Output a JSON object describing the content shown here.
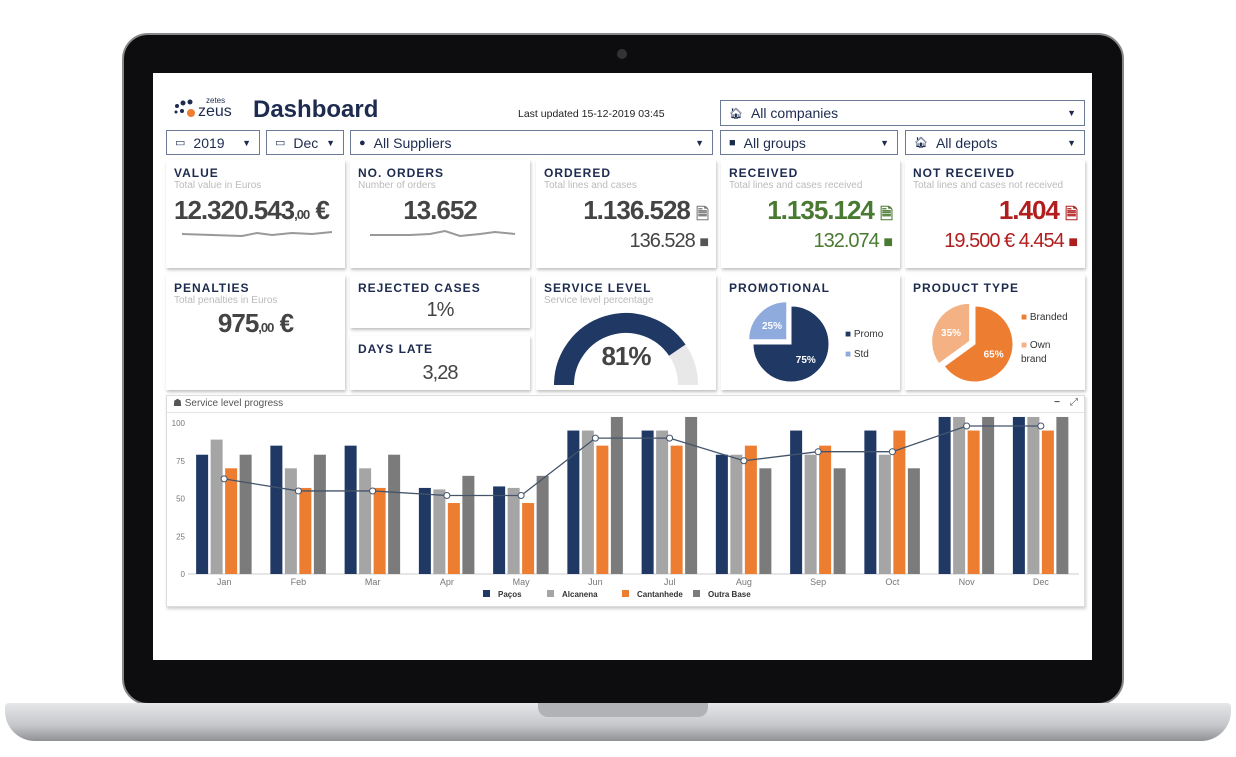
{
  "header": {
    "logo_small": "zetes",
    "logo": "zeus",
    "title": "Dashboard",
    "last_updated": "Last updated 15-12-2019 03:45"
  },
  "filters": {
    "companies": "All companies",
    "year": "2019",
    "month": "Dec",
    "suppliers": "All Suppliers",
    "groups": "All groups",
    "depots": "All depots"
  },
  "kpis": {
    "value": {
      "title": "VALUE",
      "subtitle": "Total value in Euros",
      "int": "12.320.543",
      "dec": ",00",
      "unit": "€"
    },
    "orders": {
      "title": "NO. ORDERS",
      "subtitle": "Number of orders",
      "value": "13.652"
    },
    "ordered": {
      "title": "ORDERED",
      "subtitle": "Total lines and cases",
      "lines": "1.136.528",
      "cases": "136.528"
    },
    "received": {
      "title": "RECEIVED",
      "subtitle": "Total lines and cases received",
      "lines": "1.135.124",
      "cases": "132.074",
      "color": "#4a7a32"
    },
    "not_received": {
      "title": "NOT RECEIVED",
      "subtitle": "Total lines and cases not received",
      "lines": "1.404",
      "value": "19.500 €",
      "cases": "4.454",
      "color": "#b01e1e"
    },
    "penalties": {
      "title": "PENALTIES",
      "subtitle": "Total penalties in Euros",
      "int": "975",
      "dec": ",00",
      "unit": "€"
    },
    "rejected": {
      "title": "REJECTED CASES",
      "value": "1%"
    },
    "days_late": {
      "title": "DAYS LATE",
      "value": "3,28"
    },
    "service_level": {
      "title": "SERVICE LEVEL",
      "subtitle": "Service level percentage",
      "value": "81%",
      "percent": 81
    },
    "promotional": {
      "title": "PROMOTIONAL",
      "slices": [
        {
          "label": "Promo",
          "value": 75,
          "text": "75%",
          "color": "#1f3864"
        },
        {
          "label": "Std",
          "value": 25,
          "text": "25%",
          "color": "#8faadc"
        }
      ]
    },
    "product_type": {
      "title": "PRODUCT TYPE",
      "slices": [
        {
          "label": "Branded",
          "value": 65,
          "text": "65%",
          "color": "#ed7d31"
        },
        {
          "label": "Own brand",
          "value": 35,
          "text": "35%",
          "color": "#f4b183"
        }
      ]
    }
  },
  "chart_panel": {
    "title": "Service level progress",
    "minimize": "−",
    "expand": "⤢"
  },
  "chart_data": {
    "type": "bar",
    "categories": [
      "Jan",
      "Feb",
      "Mar",
      "Apr",
      "May",
      "Jun",
      "Jul",
      "Aug",
      "Sep",
      "Oct",
      "Nov",
      "Dec"
    ],
    "y_ticks": [
      "0",
      "25",
      "50",
      "75",
      "100"
    ],
    "ylim": [
      0,
      105
    ],
    "grid": false,
    "legend": "bottom",
    "series": [
      {
        "name": "Paços",
        "color": "#1f3864",
        "values": [
          79,
          85,
          85,
          57,
          58,
          95,
          95,
          79,
          95,
          95,
          104,
          104
        ]
      },
      {
        "name": "Alcanena",
        "color": "#a5a5a5",
        "values": [
          89,
          70,
          70,
          56,
          57,
          95,
          95,
          79,
          79,
          79,
          104,
          104
        ]
      },
      {
        "name": "Cantanhede",
        "color": "#ed7d31",
        "values": [
          70,
          57,
          57,
          47,
          47,
          85,
          85,
          85,
          85,
          95,
          95,
          95
        ]
      },
      {
        "name": "Outra Base",
        "color": "#7b7b7b",
        "values": [
          79,
          79,
          79,
          65,
          65,
          104,
          104,
          70,
          70,
          70,
          104,
          104
        ]
      }
    ],
    "line": {
      "color": "#44546a",
      "values": [
        63,
        55,
        55,
        52,
        52,
        90,
        90,
        75,
        81,
        81,
        98,
        98
      ]
    }
  }
}
